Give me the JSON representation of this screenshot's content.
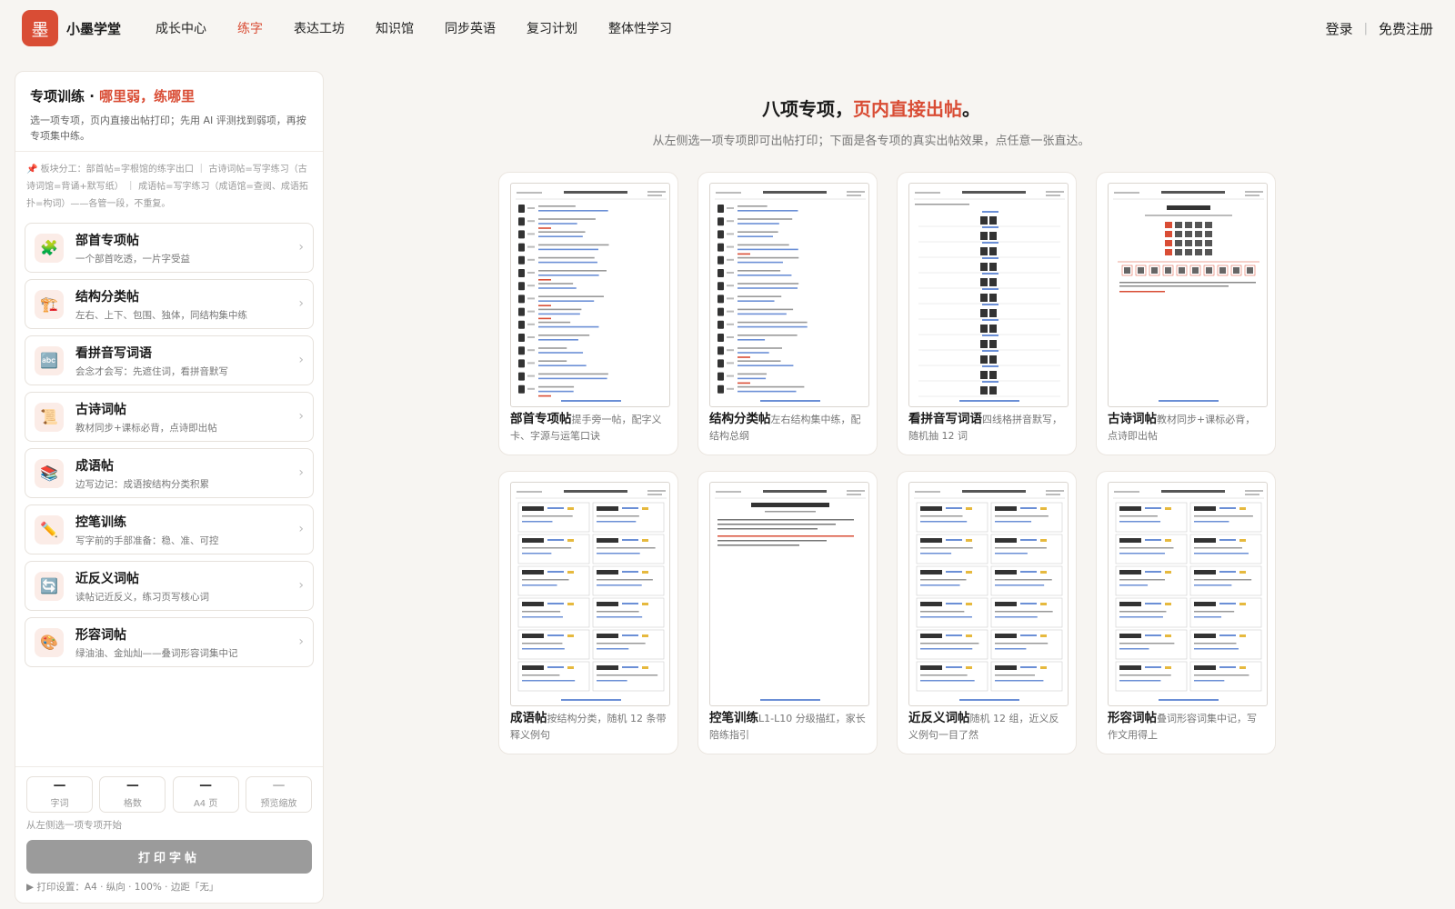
{
  "header": {
    "logo_glyph": "墨",
    "brand": "小墨学堂",
    "nav": [
      {
        "label": "成长中心",
        "active": false
      },
      {
        "label": "练字",
        "active": true
      },
      {
        "label": "表达工坊",
        "active": false
      },
      {
        "label": "知识馆",
        "active": false
      },
      {
        "label": "同步英语",
        "active": false
      },
      {
        "label": "复习计划",
        "active": false
      },
      {
        "label": "整体性学习",
        "active": false
      }
    ],
    "login": "登录",
    "separator": "|",
    "register": "免费注册"
  },
  "sidebar": {
    "title_prefix": "专项训练 · ",
    "title_highlight": "哪里弱，练哪里",
    "desc": "选一项专项，页内直接出帖打印；先用 AI 评测找到弱项，再按专项集中练。",
    "note": "📌 板块分工：部首帖=字根馆的练字出口 ｜ 古诗词帖=写字练习（古诗词馆=背诵+默写纸） ｜ 成语帖=写字练习（成语馆=查阅、成语拓扑=构词）——各管一段，不重复。",
    "items": [
      {
        "icon": "🧩",
        "icon_name": "puzzle-icon",
        "title": "部首专项帖",
        "sub": "一个部首吃透，一片字受益"
      },
      {
        "icon": "🏗️",
        "icon_name": "crane-icon",
        "title": "结构分类帖",
        "sub": "左右、上下、包围、独体，同结构集中练"
      },
      {
        "icon": "🔤",
        "icon_name": "abc-icon",
        "title": "看拼音写词语",
        "sub": "会念才会写：先遮住词，看拼音默写"
      },
      {
        "icon": "📜",
        "icon_name": "scroll-icon",
        "title": "古诗词帖",
        "sub": "教材同步+课标必背，点诗即出帖"
      },
      {
        "icon": "📚",
        "icon_name": "books-icon",
        "title": "成语帖",
        "sub": "边写边记：成语按结构分类积累"
      },
      {
        "icon": "✏️",
        "icon_name": "pencil-icon",
        "title": "控笔训练",
        "sub": "写字前的手部准备：稳、准、可控"
      },
      {
        "icon": "🔄",
        "icon_name": "cycle-arrows-icon",
        "title": "近反义词帖",
        "sub": "读帖记近反义，练习页写核心词"
      },
      {
        "icon": "🎨",
        "icon_name": "palette-icon",
        "title": "形容词帖",
        "sub": "绿油油、金灿灿——叠词形容词集中记"
      }
    ],
    "stats": [
      {
        "value": "—",
        "label": "字词"
      },
      {
        "value": "—",
        "label": "格数"
      },
      {
        "value": "—",
        "label": "A4 页"
      },
      {
        "value": "—",
        "label": "预览缩放"
      }
    ],
    "hint": "从左侧选一项专项开始",
    "print_button": "打印字帖",
    "settings": "▶ 打印设置：A4 · 纵向 · 100% · 边距「无」"
  },
  "main": {
    "title_prefix": "八项专项，",
    "title_highlight": "页内直接出帖",
    "title_suffix": "。",
    "subtitle": "从左侧选一项专项即可出帖打印；下面是各专项的真实出帖效果，点任意一张直达。",
    "tiles": [
      {
        "name": "部首专项帖",
        "desc": "提手旁一帖，配字义卡、字源与运笔口诀",
        "kind": "list"
      },
      {
        "name": "结构分类帖",
        "desc": "左右结构集中练，配结构总纲",
        "kind": "list"
      },
      {
        "name": "看拼音写词语",
        "desc": "四线格拼音默写，随机抽 12 词",
        "kind": "pinyin"
      },
      {
        "name": "古诗词帖",
        "desc": "教材同步+课标必背，点诗即出帖",
        "kind": "poem"
      },
      {
        "name": "成语帖",
        "desc": "按结构分类，随机 12 条带释义例句",
        "kind": "boxes"
      },
      {
        "name": "控笔训练",
        "desc": "L1-L10 分级描红，家长陪练指引",
        "kind": "control"
      },
      {
        "name": "近反义词帖",
        "desc": "随机 12 组，近义反义例句一目了然",
        "kind": "boxes"
      },
      {
        "name": "形容词帖",
        "desc": "叠词形容词集中记，写作文用得上",
        "kind": "boxes"
      }
    ]
  }
}
